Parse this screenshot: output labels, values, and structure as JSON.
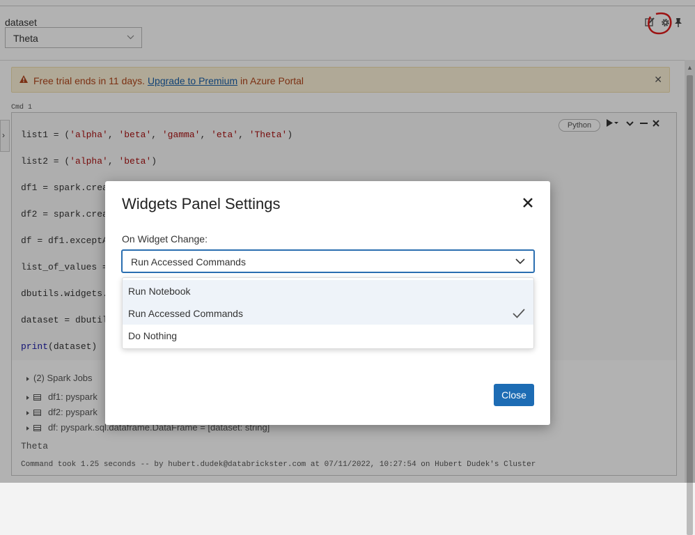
{
  "widget": {
    "label": "dataset",
    "selected": "Theta"
  },
  "banner": {
    "prefix": "Free trial ends in 11 days.",
    "link": "Upgrade to Premium",
    "suffix": " in Azure Portal"
  },
  "cell": {
    "cmd_label": "Cmd  1",
    "language": "Python",
    "code": {
      "l1_head": "list1 = (",
      "l1_s1": "'alpha'",
      "l1_s2": "'beta'",
      "l1_s3": "'gamma'",
      "l1_s4": "'eta'",
      "l1_s5": "'Theta'",
      "sep": ", ",
      "close": ")",
      "l2_head": "list2 = (",
      "l2_s1": "'alpha'",
      "l2_s2": "'beta'",
      "l3": "df1 = spark.crea",
      "l4": "df2 = spark.crea",
      "l5": "df = df1.exceptA",
      "l6": "list_of_values =",
      "l7": "dbutils.widgets.",
      "l8": "dataset = dbutil",
      "l9_fn": "print",
      "l9_rest": "(dataset)"
    },
    "jobs": {
      "spark_jobs": "(2) Spark Jobs",
      "df1": "df1:  pyspark",
      "df2": "df2:  pyspark",
      "df": "df:  pyspark.sql.dataframe.DataFrame = [dataset: string]"
    },
    "output": "Theta",
    "took": "Command took 1.25 seconds -- by hubert.dudek@databrickster.com at 07/11/2022, 10:27:54 on Hubert Dudek's Cluster"
  },
  "modal": {
    "title": "Widgets Panel Settings",
    "field_label": "On Widget Change:",
    "selected": "Run Accessed Commands",
    "options": [
      "Run Notebook",
      "Run Accessed Commands",
      "Do Nothing"
    ],
    "close_button": "Close"
  },
  "icons": {
    "edit": "edit-icon",
    "settings": "gear-icon",
    "pin": "pin-icon",
    "close": "close-icon",
    "chevron": "chevron-down-icon",
    "check": "check-icon",
    "warning": "warning-icon"
  },
  "colors": {
    "primary": "#1d6cb4",
    "warning_text": "#b1461c",
    "banner_bg": "#fdf3d8",
    "annotation": "#e01a1a"
  }
}
